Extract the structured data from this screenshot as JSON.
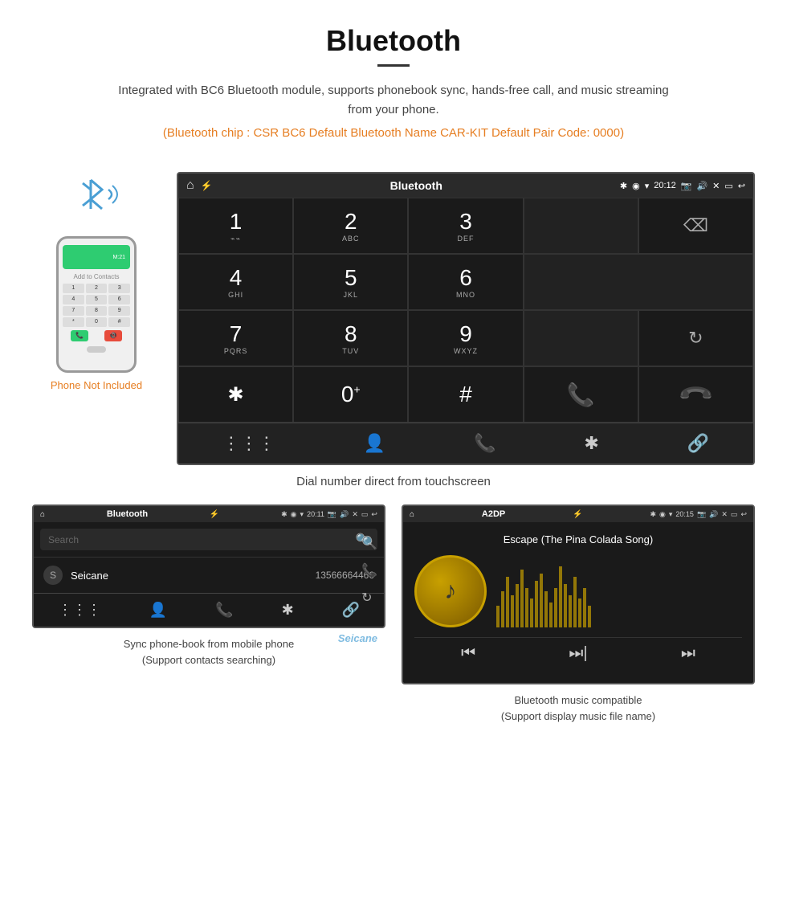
{
  "page": {
    "title": "Bluetooth",
    "description": "Integrated with BC6 Bluetooth module, supports phonebook sync, hands-free call, and music streaming from your phone.",
    "specs": "(Bluetooth chip : CSR BC6   Default Bluetooth Name CAR-KIT    Default Pair Code: 0000)",
    "dial_caption": "Dial number direct from touchscreen",
    "phone_not_included": "Phone Not Included"
  },
  "topbar": {
    "title_dial": "Bluetooth",
    "title_contacts": "Bluetooth",
    "title_music": "A2DP",
    "time_dial": "20:12",
    "time_contacts": "20:11",
    "time_music": "20:15"
  },
  "dialpad": {
    "keys": [
      {
        "num": "1",
        "sub": "⌁⌁"
      },
      {
        "num": "2",
        "sub": "ABC"
      },
      {
        "num": "3",
        "sub": "DEF"
      },
      {
        "num": "",
        "sub": ""
      },
      {
        "num": "⌫",
        "sub": ""
      },
      {
        "num": "4",
        "sub": "GHI"
      },
      {
        "num": "5",
        "sub": "JKL"
      },
      {
        "num": "6",
        "sub": "MNO"
      },
      {
        "num": "",
        "sub": ""
      },
      {
        "num": "",
        "sub": ""
      },
      {
        "num": "7",
        "sub": "PQRS"
      },
      {
        "num": "8",
        "sub": "TUV"
      },
      {
        "num": "9",
        "sub": "WXYZ"
      },
      {
        "num": "",
        "sub": ""
      },
      {
        "num": "↺",
        "sub": ""
      },
      {
        "num": "*",
        "sub": ""
      },
      {
        "num": "0+",
        "sub": ""
      },
      {
        "num": "#",
        "sub": ""
      },
      {
        "num": "📞call",
        "sub": ""
      },
      {
        "num": "📞hang",
        "sub": ""
      }
    ],
    "bottom_icons": [
      "⋮⋮⋮",
      "👤",
      "📞",
      "✱",
      "🔗"
    ]
  },
  "contacts": {
    "search_placeholder": "Search",
    "contact_letter": "S",
    "contact_name": "Seicane",
    "contact_number": "13566664466",
    "right_icons": [
      "🔍",
      "📞",
      "↺"
    ]
  },
  "music": {
    "track_title": "Escape (The Pina Colada Song)",
    "controls": [
      "⏮",
      "⏭|",
      "⏭"
    ]
  },
  "captions": {
    "contacts_line1": "Sync phone-book from mobile phone",
    "contacts_line2": "(Support contacts searching)",
    "music_line1": "Bluetooth music compatible",
    "music_line2": "(Support display music file name)"
  }
}
